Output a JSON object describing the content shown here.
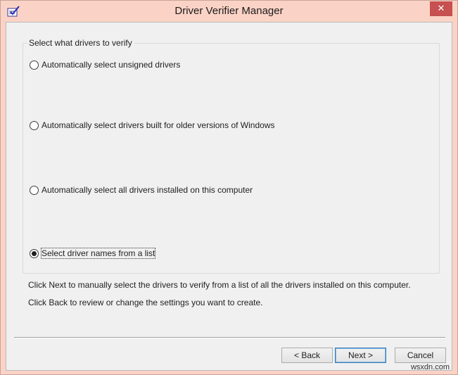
{
  "window": {
    "title": "Driver Verifier Manager",
    "close_glyph": "✕"
  },
  "group": {
    "label": "Select what drivers to verify",
    "options": [
      {
        "label": "Automatically select unsigned drivers",
        "checked": false
      },
      {
        "label": "Automatically select drivers built for older versions of Windows",
        "checked": false
      },
      {
        "label": "Automatically select all drivers installed on this computer",
        "checked": false
      },
      {
        "label": "Select driver names from a list",
        "checked": true
      }
    ]
  },
  "info": {
    "line1": "Click Next to manually select the drivers to verify from a list of all the drivers installed on this computer.",
    "line2": "Click Back to review or change the settings you want to create."
  },
  "buttons": {
    "back": "< Back",
    "next": "Next >",
    "cancel": "Cancel"
  },
  "watermark": "wsxdn.com",
  "colors": {
    "title_frame": "#fbd3c6",
    "close_button": "#c75050",
    "client_background": "#f0f0f0"
  }
}
